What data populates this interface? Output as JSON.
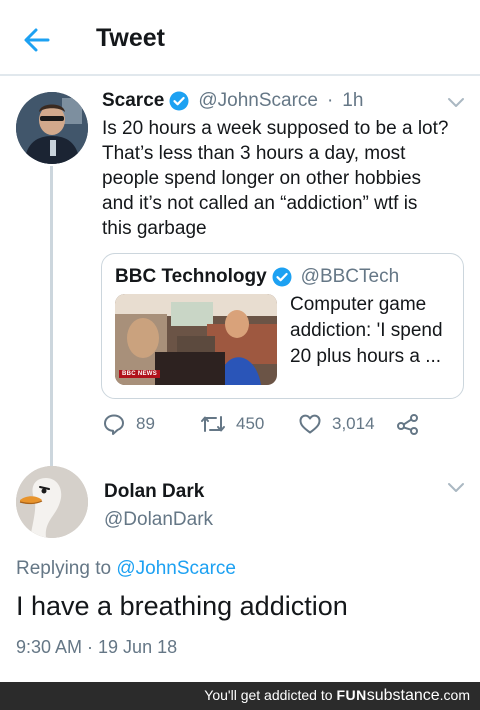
{
  "header": {
    "title": "Tweet"
  },
  "tweet": {
    "author_name": "Scarce",
    "handle": "@JohnScarce",
    "separator": "·",
    "time": "1h",
    "text_lines": [
      "Is 20 hours a week supposed to be a lot?",
      "That’s less than 3 hours a day, most",
      "people spend longer on other hobbies",
      "and it’s not called an “addiction” wtf is",
      "this garbage"
    ],
    "quote": {
      "author_name": "BBC Technology",
      "handle": "@BBCTech",
      "thumbnail_logo": "BBC NEWS",
      "text_lines": [
        "Computer game",
        "addiction: 'I spend",
        "20 plus hours a ..."
      ]
    },
    "actions": {
      "replies": "89",
      "retweets": "450",
      "likes": "3,014"
    }
  },
  "reply": {
    "author_name": "Dolan Dark",
    "handle": "@DolanDark",
    "replying_prefix": "Replying to",
    "replying_to": "@JohnScarce",
    "text": "I have a breathing addiction",
    "timestamp": "9:30 AM · 19 Jun 18"
  },
  "footer": {
    "prefix": "You'll get addicted to",
    "brand_a": "FUN",
    "brand_b": "substance",
    "brand_c": ".com"
  },
  "icons": {
    "back": "arrow-left-icon",
    "verified": "verified-badge-icon",
    "menu": "chevron-down-icon",
    "reply": "reply-icon",
    "retweet": "retweet-icon",
    "like": "heart-icon",
    "share": "share-icon"
  },
  "colors": {
    "accent": "#1da1f2",
    "muted": "#657786",
    "border": "#ccd6dd",
    "footer_bg": "#2b2b2b"
  }
}
